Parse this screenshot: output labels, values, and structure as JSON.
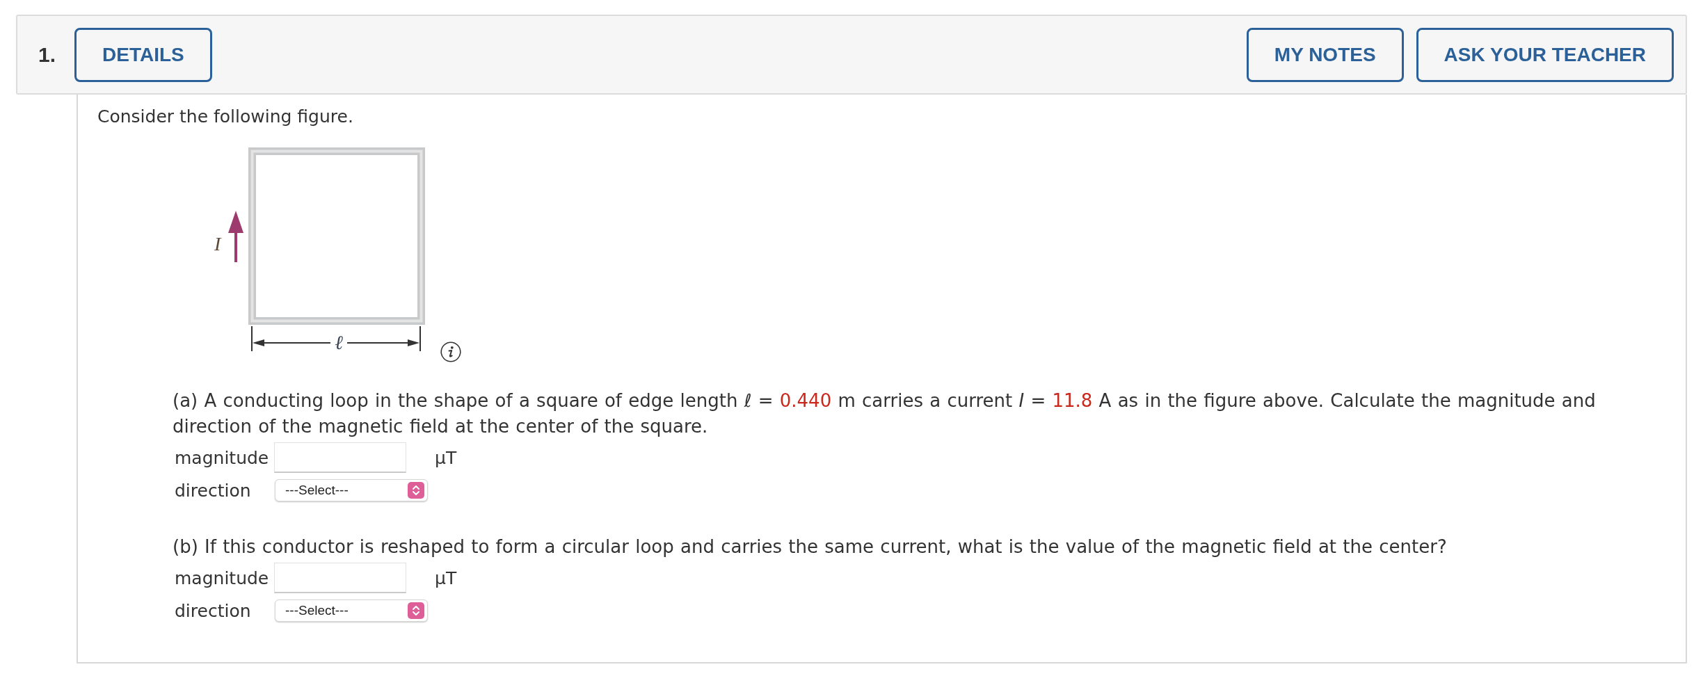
{
  "header": {
    "number": "1.",
    "left_buttons": [
      "DETAILS"
    ],
    "right_buttons": [
      "MY NOTES",
      "ASK YOUR TEACHER"
    ]
  },
  "intro": "Consider the following figure.",
  "figure": {
    "current_label": "I",
    "length_label": "ℓ"
  },
  "parts": [
    {
      "prompt": [
        {
          "kind": "text",
          "text": "(a) A conducting loop in the shape of a square of edge length ℓ = "
        },
        {
          "kind": "value",
          "text": "0.440"
        },
        {
          "kind": "text",
          "text": " m carries a current *I* = "
        },
        {
          "kind": "value",
          "text": "11.8"
        },
        {
          "kind": "text",
          "text": " A as in the figure above. Calculate the magnitude and direction of the magnetic field at the center of the square."
        }
      ],
      "answers": [
        {
          "kind": "input",
          "label": "magnitude",
          "unit": "μT"
        },
        {
          "kind": "select",
          "label": "direction",
          "value": "---Select---"
        }
      ]
    },
    {
      "prompt": [
        {
          "kind": "text",
          "text": "(b) If this conductor is reshaped to form a circular loop and carries the same current, what is the value of the magnetic field at the center?"
        }
      ],
      "answers": [
        {
          "kind": "input",
          "label": "magnitude",
          "unit": "μT"
        },
        {
          "kind": "select",
          "label": "direction",
          "value": "---Select---"
        }
      ]
    }
  ]
}
